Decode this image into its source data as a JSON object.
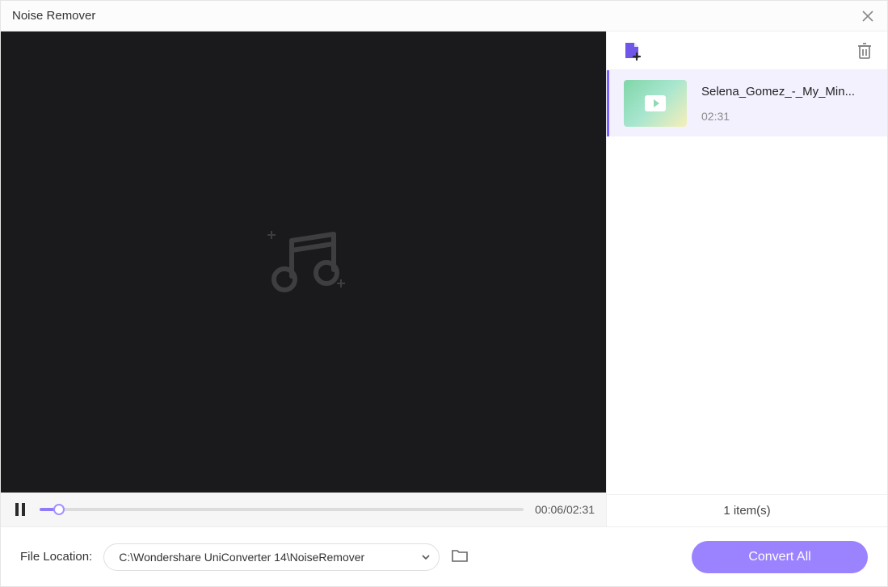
{
  "window": {
    "title": "Noise Remover"
  },
  "player": {
    "current_time": "00:06",
    "total_time": "02:31",
    "progress_pct": 4
  },
  "queue": {
    "items": [
      {
        "name": "Selena_Gomez_-_My_Min...",
        "duration": "02:31"
      }
    ],
    "count_label": "1 item(s)"
  },
  "footer": {
    "location_label": "File Location:",
    "location_path": "C:\\Wondershare UniConverter 14\\NoiseRemover",
    "convert_label": "Convert All"
  }
}
